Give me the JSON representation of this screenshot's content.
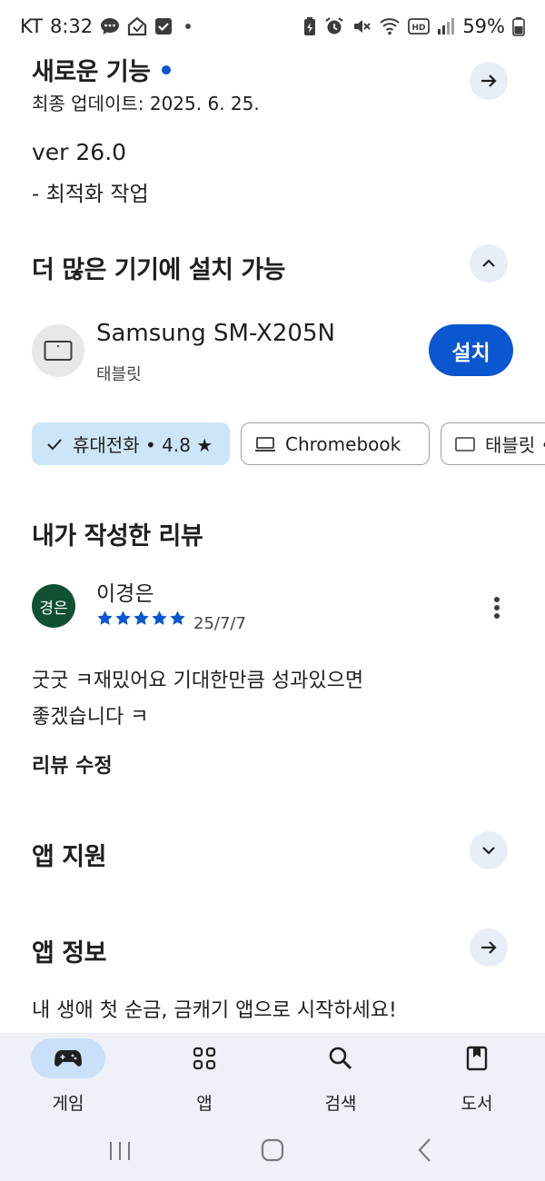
{
  "status_bar": {
    "carrier": "KT",
    "time": "8:32",
    "battery": "59%",
    "icons": [
      "chat-icon",
      "home-notification-icon",
      "checkbox-icon",
      "dot-icon",
      "battery-saver-icon",
      "alarm-icon",
      "mute-icon",
      "wifi-icon",
      "hd-icon",
      "signal-icon",
      "battery-icon"
    ]
  },
  "whats_new": {
    "title": "새로운 기능",
    "updated": "최종 업데이트: 2025. 6. 25.",
    "version": "ver 26.0",
    "note": "- 최적화 작업"
  },
  "more_devices": {
    "title": "더 많은 기기에 설치 가능",
    "device_name": "Samsung SM-X205N",
    "device_type": "태블릿",
    "install_label": "설치",
    "chips": [
      {
        "label": "휴대전화 • 4.8 ★",
        "selected": true
      },
      {
        "label": "Chromebook",
        "selected": false
      },
      {
        "label": "태블릿 •",
        "selected": false
      }
    ]
  },
  "my_review": {
    "title": "내가 작성한 리뷰",
    "avatar_text": "경은",
    "reviewer": "이경은",
    "stars": 5,
    "date": "25/7/7",
    "text_line1": "굿굿 ㅋ재밌어요 기대한만큼 성과있으면",
    "text_line2": "좋겠습니다 ㅋ",
    "edit_label": "리뷰 수정"
  },
  "app_support": {
    "title": "앱 지원"
  },
  "app_info": {
    "title": "앱 정보",
    "description": "내 생애 첫 순금, 금캐기 앱으로 시작하세요!"
  },
  "bottom_nav": [
    {
      "label": "게임",
      "icon": "gamepad-icon",
      "active": true
    },
    {
      "label": "앱",
      "icon": "apps-grid-icon",
      "active": false
    },
    {
      "label": "검색",
      "icon": "search-icon",
      "active": false
    },
    {
      "label": "도서",
      "icon": "book-icon",
      "active": false
    }
  ],
  "colors": {
    "accent": "#0b57d0",
    "chip_selected": "#cce6f7",
    "avatar_bg": "#0f5132",
    "nav_bg": "#eef2f8"
  }
}
